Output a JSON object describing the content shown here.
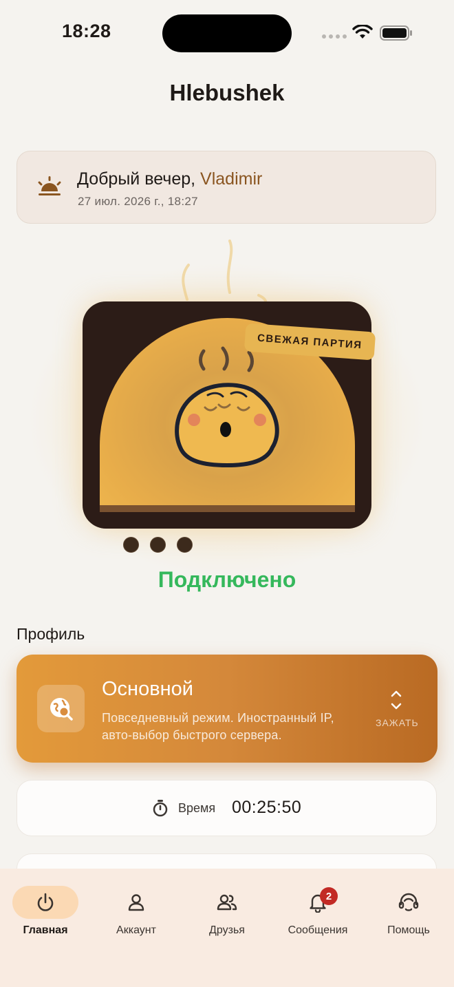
{
  "status_bar": {
    "time": "18:28"
  },
  "app": {
    "title": "Hlebushek"
  },
  "greeting": {
    "prefix": "Добрый вечер, ",
    "name": "Vladimir",
    "date": "27 июл. 2026 г., 18:27",
    "icon": "sunset-icon"
  },
  "hero": {
    "badge": "СВЕЖАЯ ПАРТИЯ",
    "knob_count": 3
  },
  "connection": {
    "status": "Подключено",
    "color": "#35b85c"
  },
  "profile": {
    "section_label": "Профиль",
    "name": "Основной",
    "description": "Повседневный режим. Иностранный IP, авто-выбор быстрого сервера.",
    "hold_label": "ЗАЖАТЬ",
    "icon": "globe-search-icon"
  },
  "timer": {
    "label": "Время",
    "value": "00:25:50",
    "icon": "stopwatch-icon"
  },
  "tabs": [
    {
      "label": "Главная",
      "icon": "power-icon",
      "active": true
    },
    {
      "label": "Аккаунт",
      "icon": "user-icon",
      "active": false
    },
    {
      "label": "Друзья",
      "icon": "users-icon",
      "active": false
    },
    {
      "label": "Сообщения",
      "icon": "bell-icon",
      "active": false,
      "badge": "2"
    },
    {
      "label": "Помощь",
      "icon": "headset-icon",
      "active": false
    }
  ],
  "colors": {
    "background": "#f5f3ef",
    "accent": "#d4883a",
    "name_accent": "#8a5520",
    "badge": "#c22a25"
  }
}
